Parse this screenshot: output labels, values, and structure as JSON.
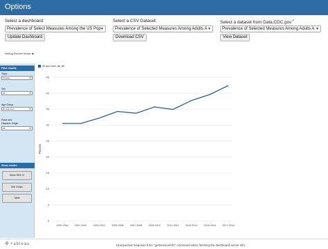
{
  "header": {
    "title": "Options"
  },
  "controls": {
    "dashboard": {
      "label": "Select a dashboard:",
      "selected": "Prevalence of Select Measures Among the US Pop",
      "button": "Update Dashboard"
    },
    "csv": {
      "label": "Select a CSV Dataset:",
      "selected": "Prevalence of Selected Measures Among Adults A",
      "button": "Download CSV"
    },
    "dataset": {
      "label": "Select a dataset from Data.CDC.gov",
      "selected": "Prevalence of Selected Measures Among Adults A",
      "button": "View Dataset"
    }
  },
  "debug_text": "Debug Render Mode: ■",
  "sidebar": {
    "filter_header": "Filter results",
    "topic_label": "Topic",
    "topic_value": "Obesity",
    "sex_label": "Sex",
    "sex_value": "All",
    "age_label": "Age Group",
    "age_value": "20 and over",
    "race_label_1": "Race and",
    "race_label_2": "Hispanic Origin",
    "race_value": "All",
    "show_header": "Show results",
    "btn_ci": "Show 95% CI",
    "btn_bar": "Bar Graph",
    "btn_table": "Table"
  },
  "chart_data": {
    "type": "line",
    "legend": "20 and over, All, All",
    "ylabel": "Percent",
    "xlabel": "",
    "categories": [
      "1999-2000",
      "2001-2002",
      "2003-2004",
      "2005-2006",
      "2007-2008",
      "2009-2010",
      "2011-2012",
      "2013-2014",
      "2015-2016",
      "2017-2018"
    ],
    "series": [
      {
        "name": "20 and over, All, All",
        "values": [
          30.5,
          30.5,
          32.2,
          34.3,
          33.7,
          35.7,
          34.9,
          37.7,
          39.6,
          42.4
        ]
      }
    ],
    "yticks": [
      0,
      5,
      10,
      15,
      20,
      25,
      30,
      35,
      40,
      45
    ],
    "ylim": [
      0,
      45
    ],
    "grid": true,
    "line_color": "#2e5c8a"
  },
  "footer": {
    "brand": "+ableau",
    "message": "Unexpected response from \"getSessionInfo\" command when fetching the dashboard server info."
  }
}
